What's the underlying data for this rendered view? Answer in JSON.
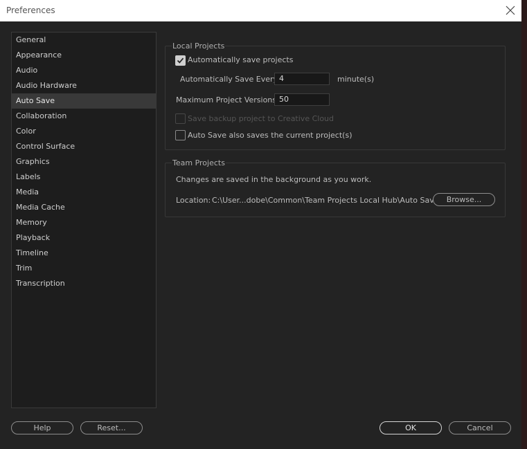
{
  "window": {
    "title": "Preferences"
  },
  "sidebar": {
    "items": [
      {
        "label": "General"
      },
      {
        "label": "Appearance"
      },
      {
        "label": "Audio"
      },
      {
        "label": "Audio Hardware"
      },
      {
        "label": "Auto Save",
        "selected": true
      },
      {
        "label": "Collaboration"
      },
      {
        "label": "Color"
      },
      {
        "label": "Control Surface"
      },
      {
        "label": "Graphics"
      },
      {
        "label": "Labels"
      },
      {
        "label": "Media"
      },
      {
        "label": "Media Cache"
      },
      {
        "label": "Memory"
      },
      {
        "label": "Playback"
      },
      {
        "label": "Timeline"
      },
      {
        "label": "Trim"
      },
      {
        "label": "Transcription"
      }
    ]
  },
  "local_projects": {
    "title": "Local Projects",
    "auto_save": {
      "label": "Automatically save projects",
      "checked": true
    },
    "save_every": {
      "label": "Automatically Save Every:",
      "value": "4",
      "unit": "minute(s)"
    },
    "max_versions": {
      "label": "Maximum Project Versions:",
      "value": "50"
    },
    "backup_cloud": {
      "label": "Save backup project to Creative Cloud",
      "checked": false,
      "disabled": true
    },
    "save_current": {
      "label": "Auto Save also saves the current project(s)",
      "checked": false
    }
  },
  "team_projects": {
    "title": "Team Projects",
    "description": "Changes are saved in the background as you work.",
    "location_label": "Location:",
    "location_path": "C:\\User...dobe\\Common\\Team Projects Local Hub\\Auto Saves",
    "browse_label": "Browse..."
  },
  "footer": {
    "help": "Help",
    "reset": "Reset...",
    "ok": "OK",
    "cancel": "Cancel"
  },
  "icons": {
    "close": "close-icon",
    "checkmark": "checkmark-icon"
  }
}
